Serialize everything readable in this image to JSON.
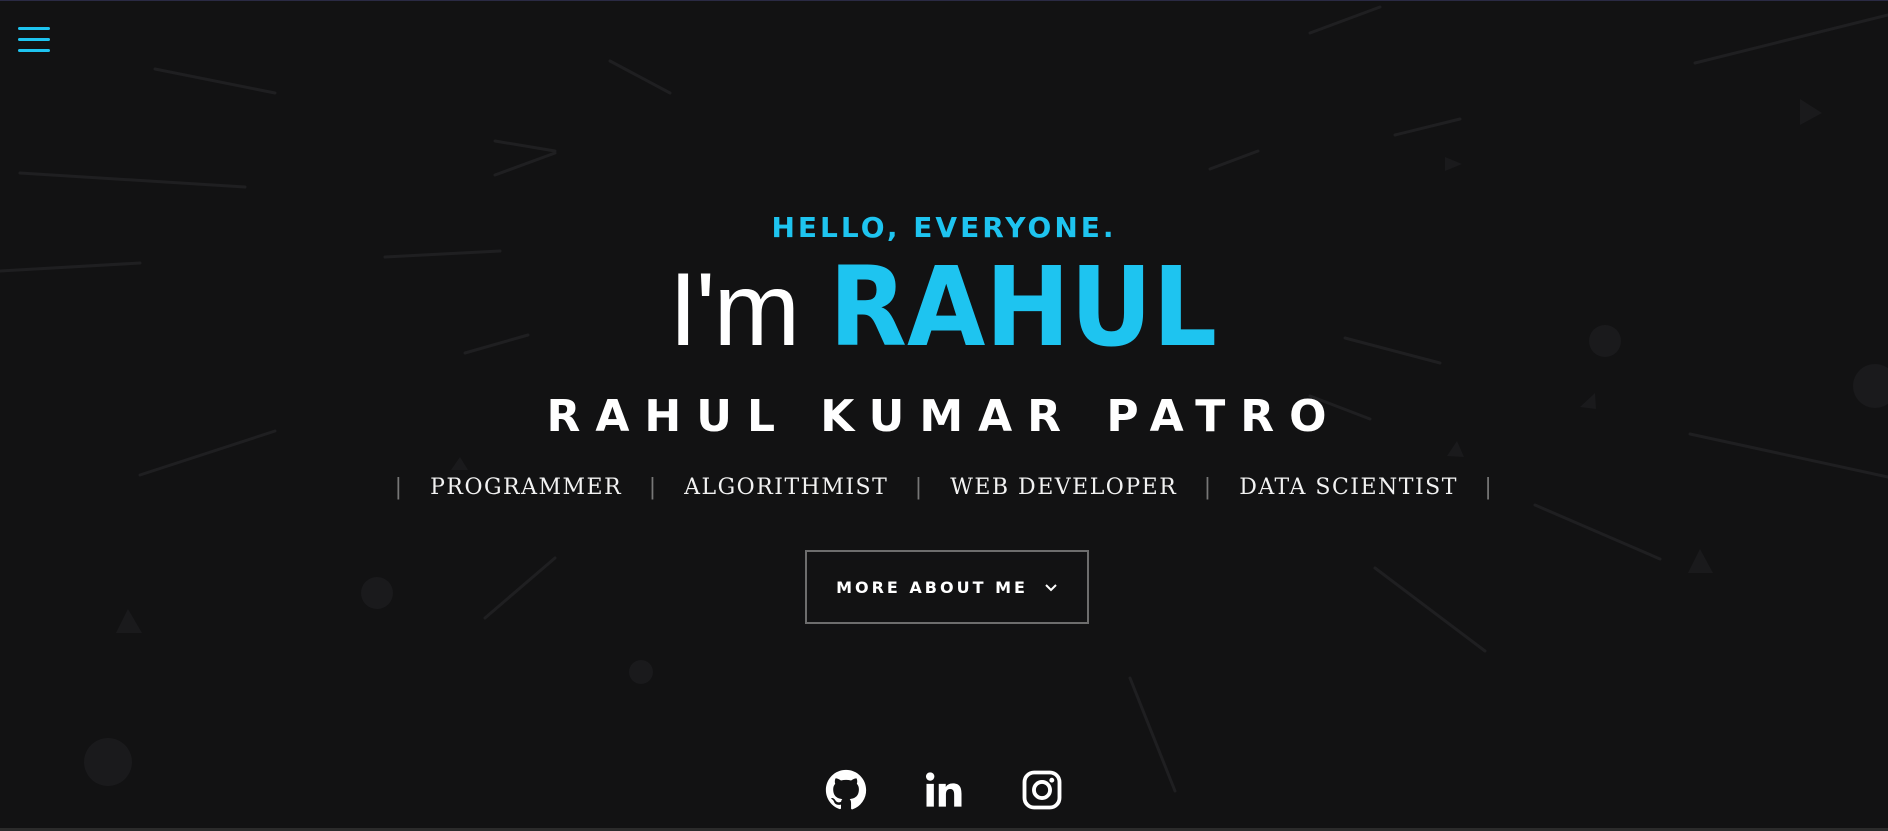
{
  "nav": {
    "menu_icon": "hamburger-menu-icon"
  },
  "hero": {
    "greeting": "HELLO, EVERYONE.",
    "im_text": "I'm",
    "brand_name": "RAHUL",
    "full_name": "RAHUL KUMAR PATRO",
    "roles": [
      "PROGRAMMER",
      "ALGORITHMIST",
      "WEB DEVELOPER",
      "DATA SCIENTIST"
    ],
    "more_button_label": "MORE ABOUT ME",
    "more_button_icon": "chevron-down-icon"
  },
  "socials": [
    {
      "name": "github",
      "icon": "github-icon"
    },
    {
      "name": "linkedin",
      "icon": "linkedin-icon"
    },
    {
      "name": "instagram",
      "icon": "instagram-icon"
    }
  ],
  "colors": {
    "background": "#121213",
    "accent": "#1ec4f0",
    "text": "#ffffff",
    "button_border": "#6d6d6d"
  }
}
